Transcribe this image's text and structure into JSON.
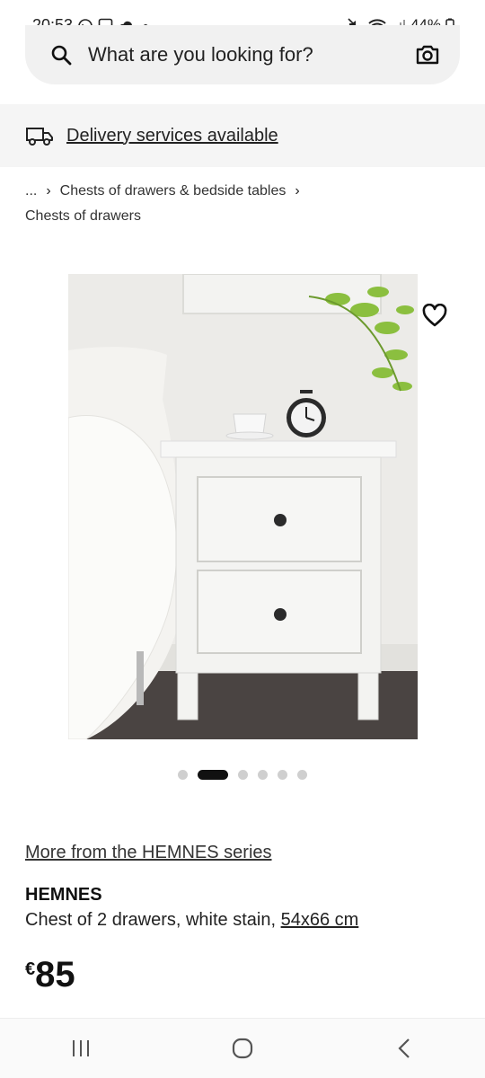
{
  "status_bar": {
    "time": "20:53",
    "battery": "44%"
  },
  "search": {
    "placeholder": "What are you looking for?"
  },
  "delivery": {
    "label": "Delivery services available"
  },
  "breadcrumb": {
    "ellipsis": "...",
    "parent": "Chests of drawers & bedside tables",
    "current": "Chests of drawers"
  },
  "carousel": {
    "total": 6,
    "active_index": 1
  },
  "product": {
    "series_link": "More from the HEMNES series",
    "name": "HEMNES",
    "description": "Chest of 2 drawers, white stain, ",
    "size": "54x66 cm",
    "currency": "€",
    "price": "85"
  },
  "colors": {
    "background": "#ffffff",
    "banner_bg": "#f5f5f5",
    "search_bg": "#f1f1f1",
    "text": "#111111"
  },
  "icons": {
    "search": "search-icon",
    "camera": "camera-icon",
    "delivery": "truck-icon",
    "wishlist": "heart-outline-icon",
    "nav_recent": "recent-apps-icon",
    "nav_home": "home-icon",
    "nav_back": "back-icon"
  }
}
